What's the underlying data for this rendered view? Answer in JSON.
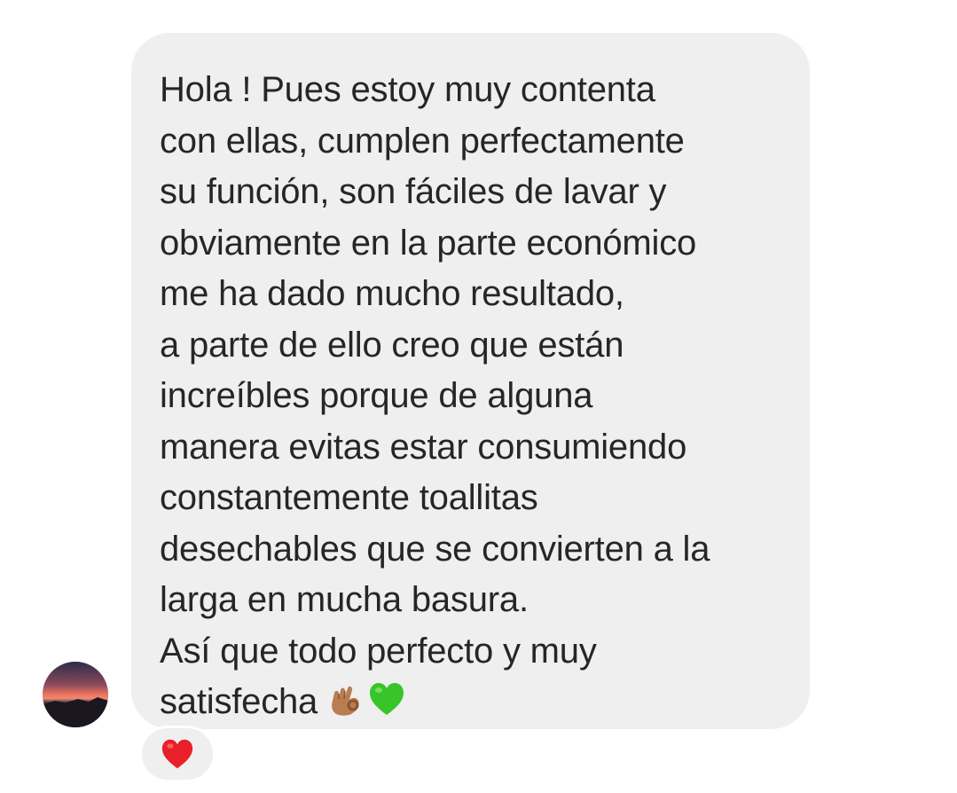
{
  "message": {
    "lines": [
      "Hola ! Pues estoy muy contenta",
      "con ellas, cumplen perfectamente",
      "su función, son fáciles de lavar y",
      "obviamente en la parte económico",
      "me ha dado mucho resultado,",
      "a parte de ello creo que están",
      "increíbles porque de alguna",
      "manera evitas estar consumiendo",
      "constantemente toallitas",
      "desechables que se convierten a la",
      "larga en mucha basura.",
      "Así que todo perfecto y muy",
      "satisfecha"
    ],
    "trailing_emojis": [
      "ok-hand-emoji",
      "green-heart-emoji"
    ],
    "bubble_color": "#efefef",
    "text_color": "#262626"
  },
  "sender": {
    "avatar": "sunset-avatar"
  },
  "reaction": {
    "emoji": "red-heart-emoji",
    "color": "#e8202a"
  }
}
